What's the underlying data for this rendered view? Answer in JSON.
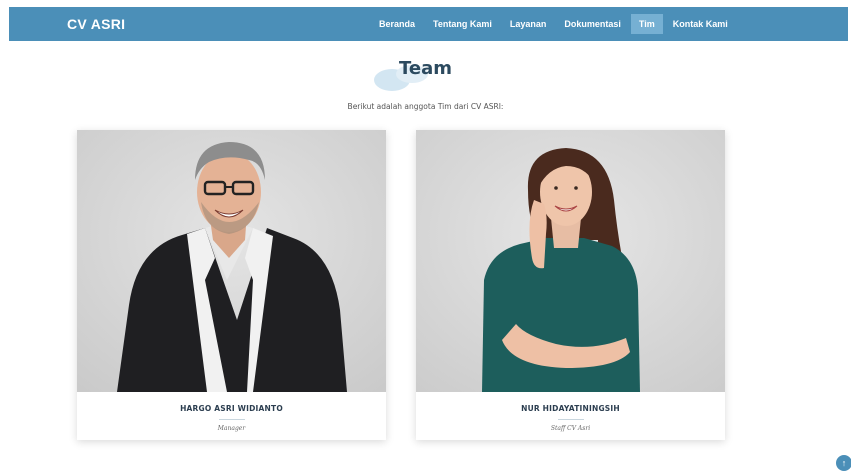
{
  "brand": {
    "name": "CV ASRI"
  },
  "nav": {
    "items": [
      {
        "label": "Beranda"
      },
      {
        "label": "Tentang Kami"
      },
      {
        "label": "Layanan"
      },
      {
        "label": "Dokumentasi"
      },
      {
        "label": "Tim"
      },
      {
        "label": "Kontak Kami"
      }
    ],
    "active": "Tim"
  },
  "section": {
    "title": "Team",
    "subtitle": "Berikut adalah anggota Tim dari CV ASRI:"
  },
  "team": [
    {
      "name": "HARGO ASRI WIDIANTO",
      "role": "Manager"
    },
    {
      "name": "NUR HIDAYATININGSIH",
      "role": "Staff CV Asri"
    }
  ],
  "colors": {
    "navbar": "#4b8fb8",
    "nav_active": "#76b0d3",
    "title_blob": "#cfe3f0"
  },
  "icons": {
    "scroll_top": "arrow-up-icon"
  }
}
